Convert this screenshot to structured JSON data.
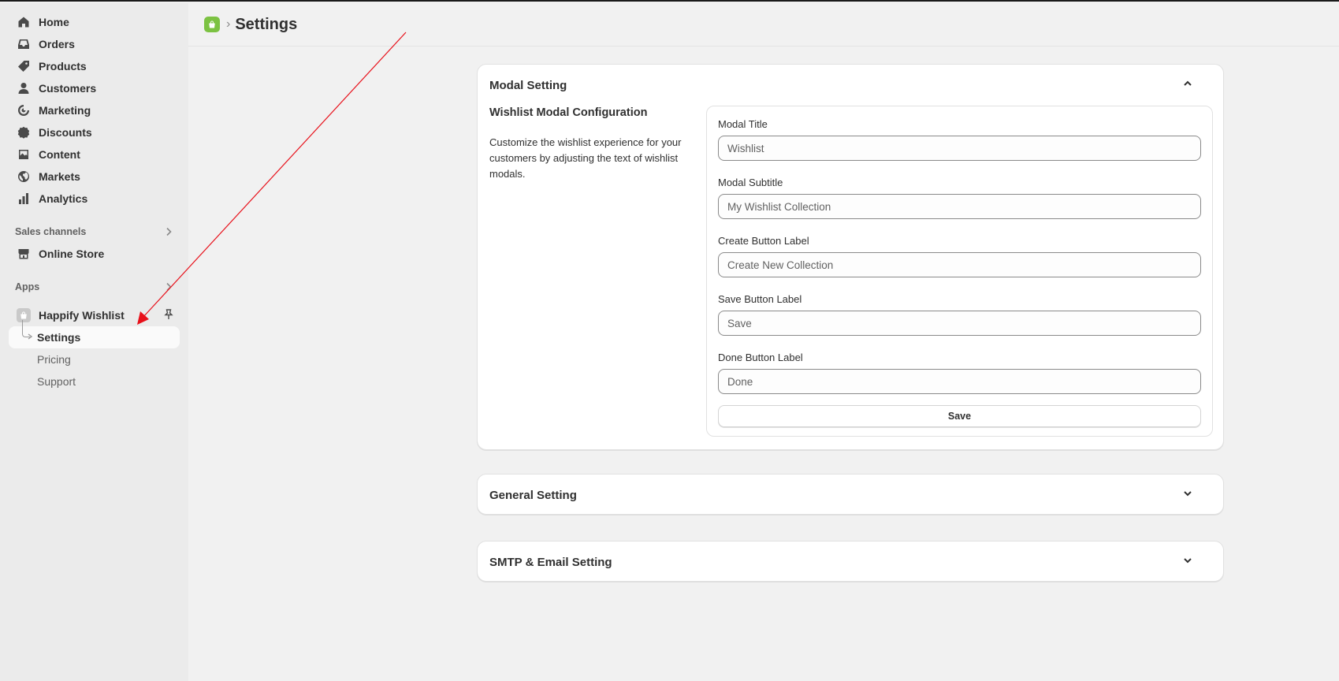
{
  "sidebar": {
    "nav": [
      {
        "label": "Home",
        "icon": "home-icon"
      },
      {
        "label": "Orders",
        "icon": "inbox-icon"
      },
      {
        "label": "Products",
        "icon": "tag-icon"
      },
      {
        "label": "Customers",
        "icon": "person-icon"
      },
      {
        "label": "Marketing",
        "icon": "target-icon"
      },
      {
        "label": "Discounts",
        "icon": "discount-icon"
      },
      {
        "label": "Content",
        "icon": "image-icon"
      },
      {
        "label": "Markets",
        "icon": "globe-icon"
      },
      {
        "label": "Analytics",
        "icon": "bar-chart-icon"
      }
    ],
    "sales_channels_label": "Sales channels",
    "online_store_label": "Online Store",
    "apps_label": "Apps",
    "app_name": "Happify Wishlist",
    "app_sub": [
      "Settings",
      "Pricing",
      "Support"
    ]
  },
  "header": {
    "title": "Settings"
  },
  "cards": {
    "modal": {
      "title": "Modal Setting",
      "section_title": "Wishlist Modal Configuration",
      "section_desc": "Customize the wishlist experience for your customers by adjusting the text of wishlist modals.",
      "fields": [
        {
          "label": "Modal Title",
          "placeholder": "Wishlist"
        },
        {
          "label": "Modal Subtitle",
          "placeholder": "My Wishlist Collection"
        },
        {
          "label": "Create Button Label",
          "placeholder": "Create New Collection"
        },
        {
          "label": "Save Button Label",
          "placeholder": "Save"
        },
        {
          "label": "Done Button Label",
          "placeholder": "Done"
        }
      ],
      "save_label": "Save"
    },
    "general": {
      "title": "General Setting"
    },
    "smtp": {
      "title": "SMTP & Email Setting"
    }
  },
  "colors": {
    "accent_app_logo": "#7cc242",
    "annotation_arrow": "#e8101a"
  }
}
